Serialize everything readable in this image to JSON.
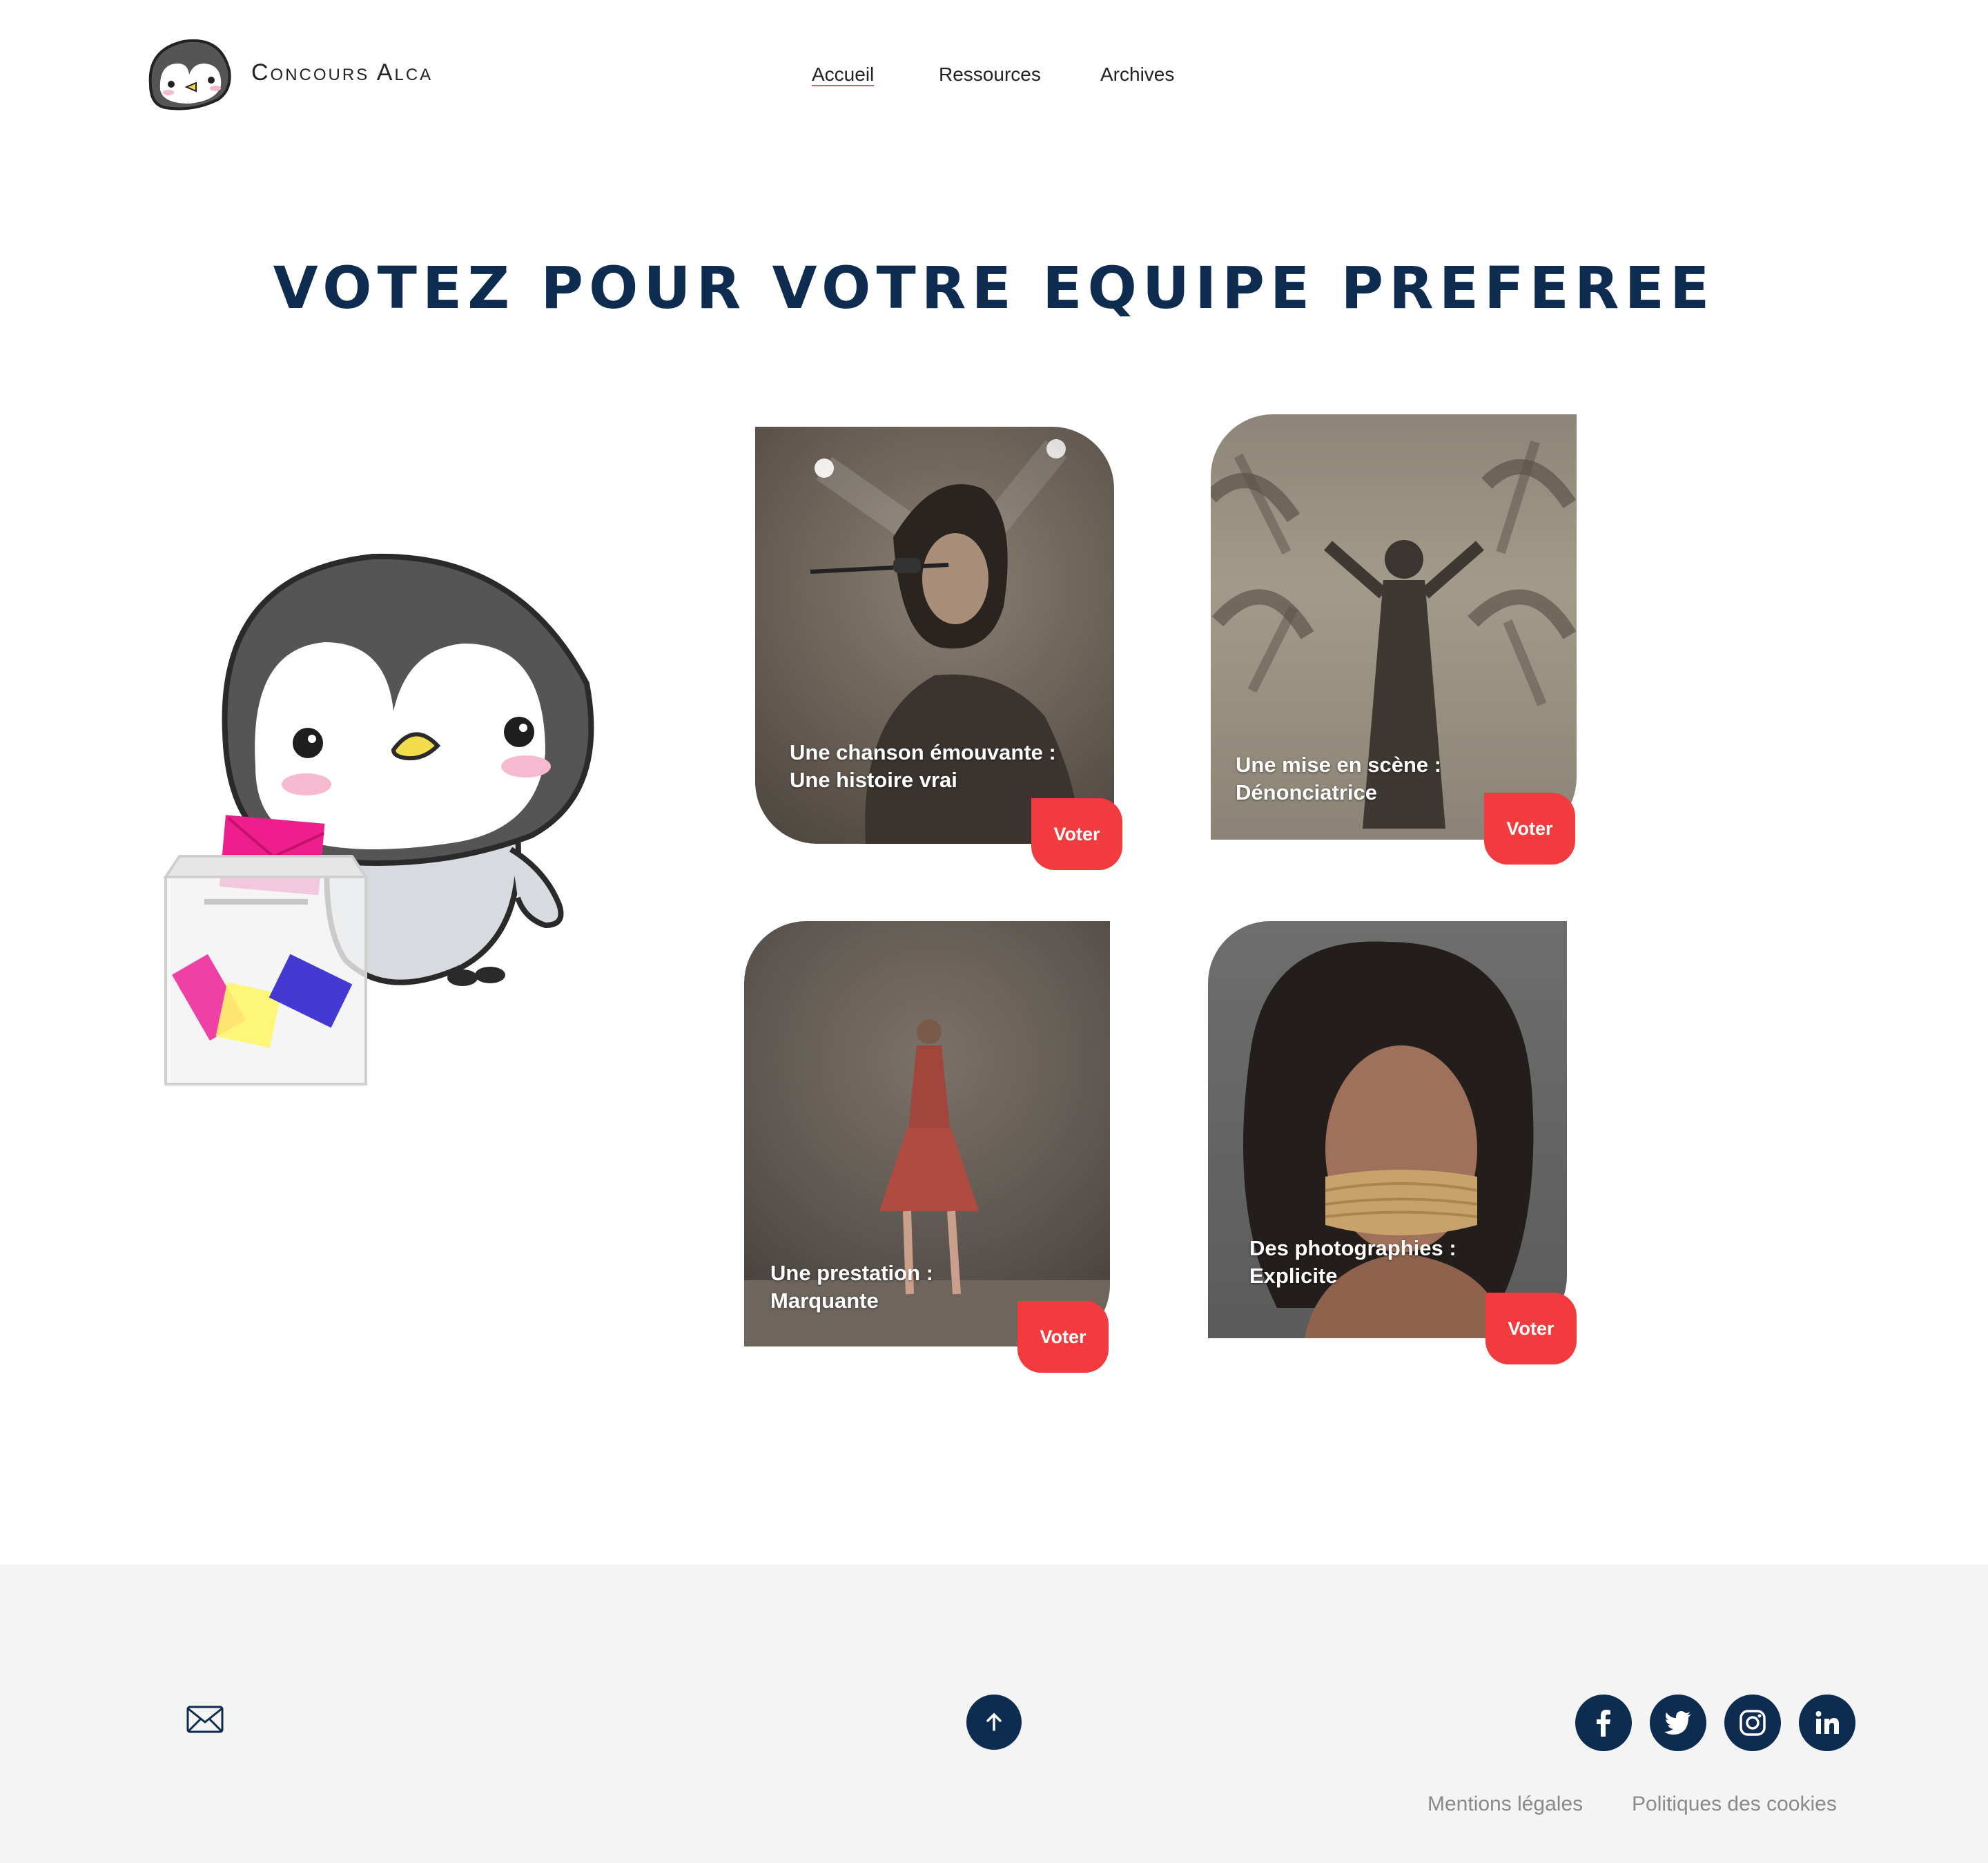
{
  "brand": {
    "name": "Concours Alca"
  },
  "nav": {
    "items": [
      {
        "label": "Accueil",
        "active": true
      },
      {
        "label": "Ressources"
      },
      {
        "label": "Archives"
      }
    ]
  },
  "page": {
    "title": "VOTEZ POUR VOTRE EQUIPE PREFEREE"
  },
  "cards": [
    {
      "line1": "Une chanson émouvante :",
      "line2": "Une histoire vrai",
      "vote": "Voter"
    },
    {
      "line1": "Une mise en scène :",
      "line2": "Dénonciatrice",
      "vote": "Voter"
    },
    {
      "line1": "Une prestation :",
      "line2": "Marquante",
      "vote": "Voter"
    },
    {
      "line1": "Des photographies :",
      "line2": "Explicite",
      "vote": "Voter"
    }
  ],
  "footer": {
    "links": [
      "Mentions légales",
      "Politiques des cookies"
    ],
    "icons": [
      "mail-icon",
      "arrow-up-icon",
      "facebook-icon",
      "twitter-icon",
      "instagram-icon",
      "linkedin-icon"
    ]
  },
  "colors": {
    "navy": "#0e2c4f",
    "vote_red": "#f23b3f",
    "footer_bg": "#f4f4f4"
  }
}
